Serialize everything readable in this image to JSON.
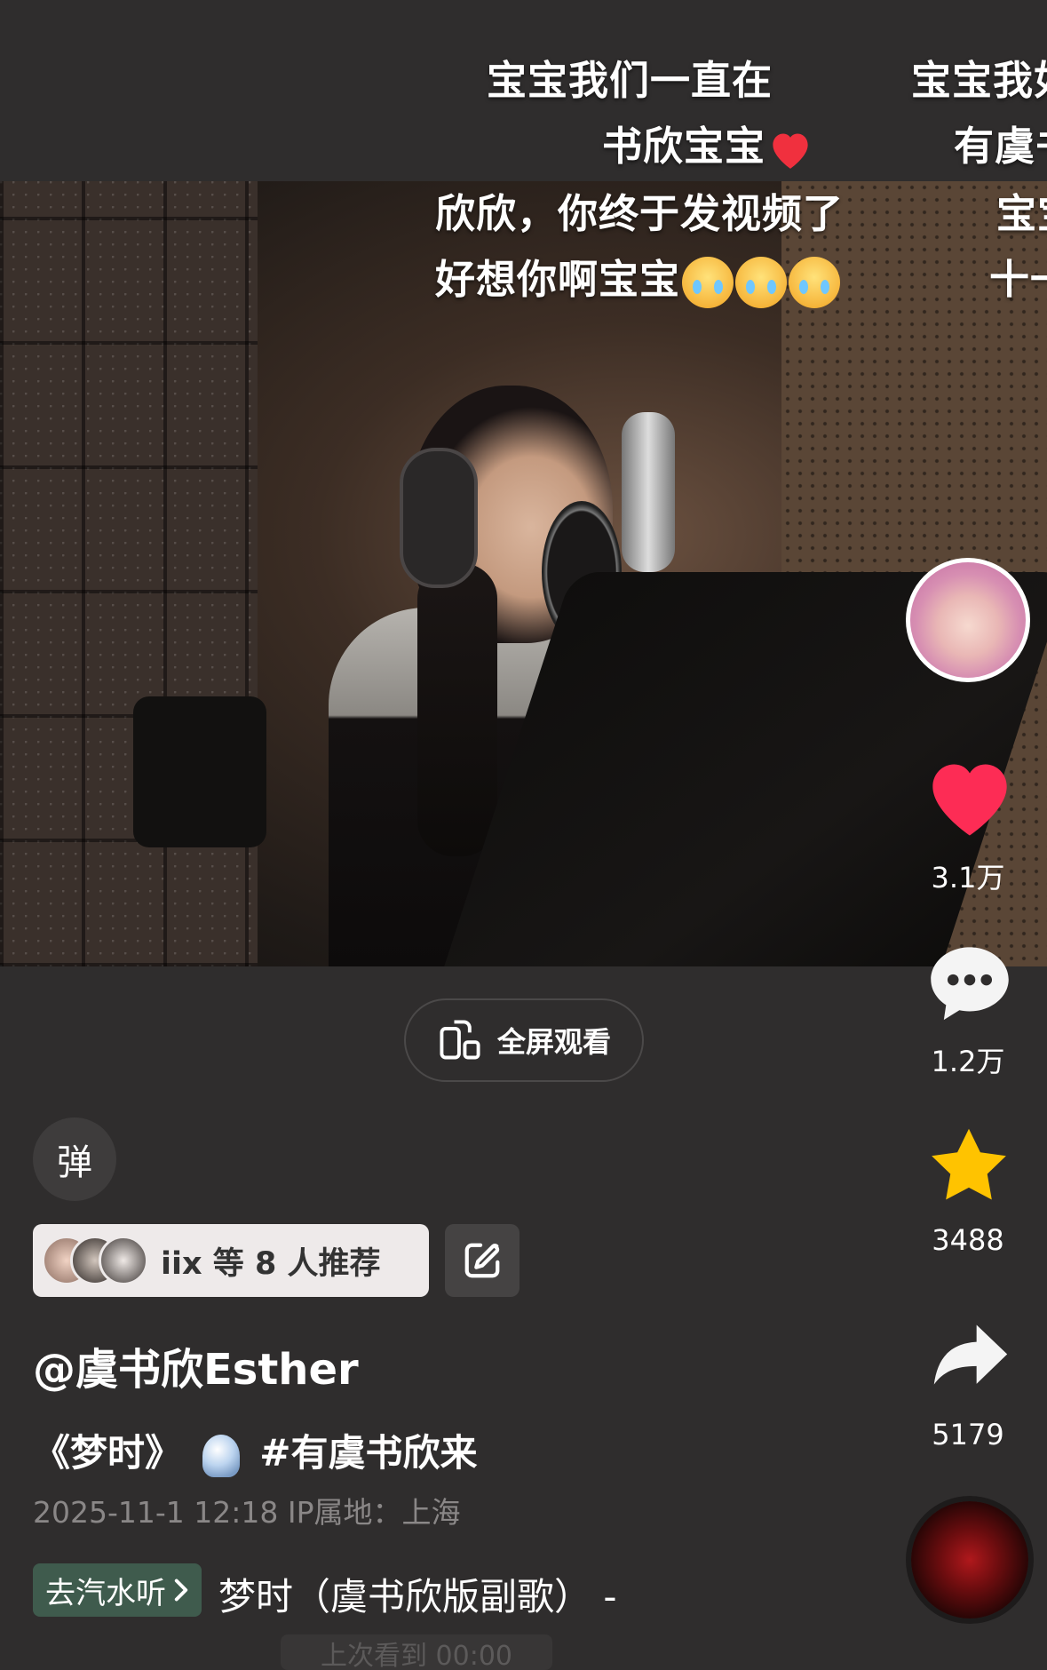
{
  "danmaku": {
    "col1_line1": "宝宝我们一直在",
    "col1_line2": "书欣宝宝",
    "col1_line3": "欣欣，你终于发视频了",
    "col1_line4": "好想你啊宝宝",
    "col2_line1": "宝宝我如",
    "col2_line2": "有虞书",
    "col2_line3": "宝宝",
    "col2_line4": "十一"
  },
  "actions": {
    "likes": "3.1万",
    "comments": "1.2万",
    "favorites": "3488",
    "shares": "5179"
  },
  "fullscreen_label": "全屏观看",
  "danmu_toggle_label": "弹",
  "recommend": {
    "text": "iix 等 8 人推荐"
  },
  "author": "@虞书欣Esther",
  "caption": {
    "title": "《梦时》",
    "hashtag": "#有虞书欣来"
  },
  "meta": "2025-11-1 12:18  IP属地：上海",
  "music": {
    "tag": "去汽水听",
    "title": "梦时（虞书欣版副歌） -"
  },
  "peek_text": "上次看到 00:00",
  "colors": {
    "background": "#2f2d2d",
    "like": "#fd2c55",
    "favorite": "#ffc300",
    "music_tag": "#3f5b4d"
  }
}
